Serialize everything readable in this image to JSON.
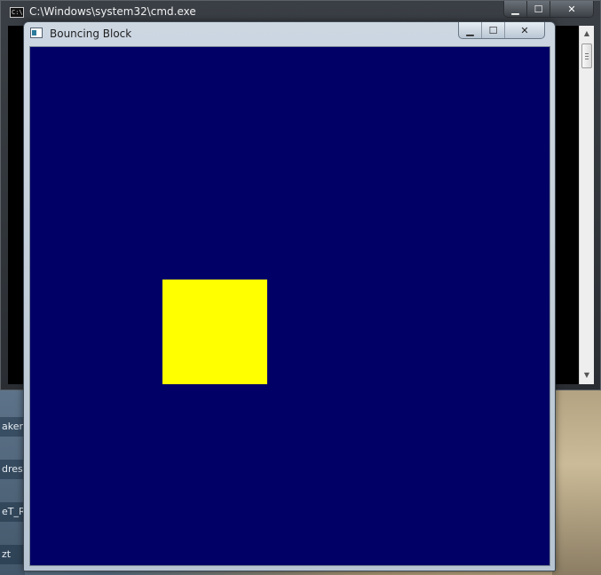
{
  "desktop": {
    "taskbar_fragments": [
      "aker",
      "drest",
      "eT_R",
      "zt"
    ]
  },
  "cmd_window": {
    "title": "C:\\Windows\\system32\\cmd.exe",
    "icon": "console-icon",
    "icon_text": "C:\\",
    "buttons": {
      "minimize": "minimize-icon",
      "maximize": "maximize-icon",
      "close": "close-icon"
    }
  },
  "game_window": {
    "title": "Bouncing Block",
    "icon": "app-window-icon",
    "buttons": {
      "minimize": "minimize-icon",
      "maximize": "maximize-icon",
      "close": "close-icon"
    },
    "canvas": {
      "background_color": "#000066",
      "block_color": "#ffff00"
    }
  },
  "glyphs": {
    "minimize": "▁",
    "maximize": "☐",
    "close": "✕",
    "scroll_up": "▲",
    "scroll_down": "▼"
  }
}
